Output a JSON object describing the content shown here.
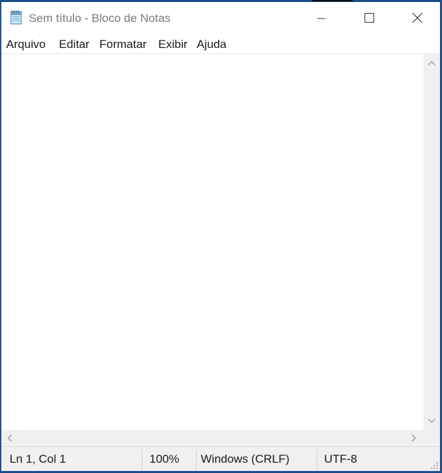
{
  "window": {
    "title": "Sem título - Bloco de Notas",
    "icon": "notepad-icon"
  },
  "menu": {
    "items": [
      {
        "label": "Arquivo"
      },
      {
        "label": "Editar"
      },
      {
        "label": "Formatar"
      },
      {
        "label": "Exibir"
      },
      {
        "label": "Ajuda"
      }
    ]
  },
  "editor": {
    "content": ""
  },
  "status": {
    "position": "Ln 1, Col 1",
    "zoom": "100%",
    "line_ending": "Windows (CRLF)",
    "encoding": "UTF-8"
  },
  "colors": {
    "desktop": "#1a4a8a",
    "statusbar": "#f0f0f0",
    "title_text": "#7a7a7a"
  }
}
